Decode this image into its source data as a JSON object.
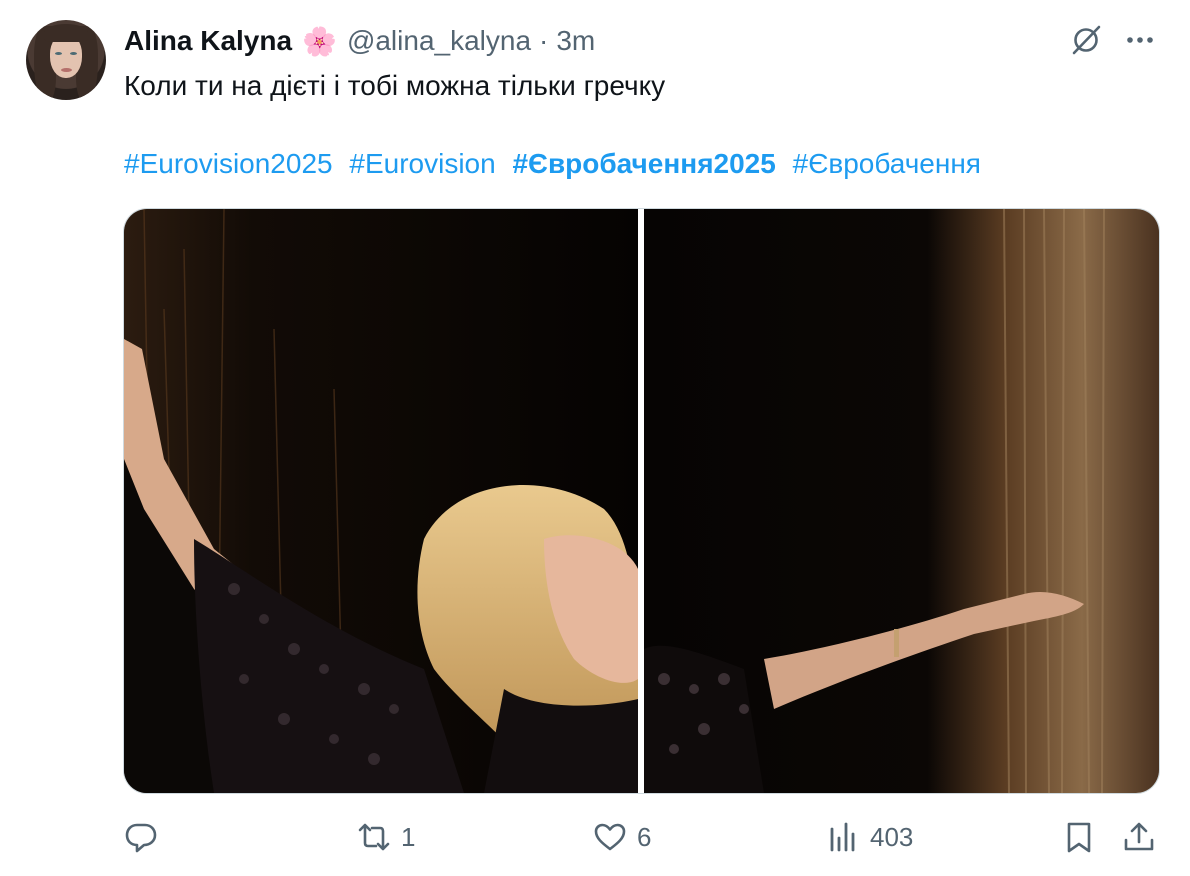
{
  "author": {
    "name": "Alina Kalyna",
    "emoji": "🌸",
    "handle": "@alina_kalyna",
    "separator": "·",
    "time": "3m"
  },
  "tweet": {
    "text": "Коли ти на дієті і тобі можна тільки гречку",
    "hashtags": [
      {
        "label": "#Eurovision2025",
        "bold": false
      },
      {
        "label": "#Eurovision",
        "bold": false
      },
      {
        "label": "#Євробачення2025",
        "bold": true
      },
      {
        "label": "#Євробачення",
        "bold": false
      }
    ]
  },
  "media": {
    "images": [
      {
        "name": "left-photo-singer-lace-dress"
      },
      {
        "name": "right-photo-arm-in-buckwheat-stream"
      }
    ]
  },
  "actions": {
    "reply_count": "",
    "retweet_count": "1",
    "like_count": "6",
    "views_count": "403"
  },
  "icons": {
    "reply": "reply-icon",
    "retweet": "retweet-icon",
    "like": "heart-icon",
    "views": "views-icon",
    "bookmark": "bookmark-icon",
    "share": "share-icon",
    "grok": "grok-icon",
    "more": "more-icon"
  },
  "colors": {
    "link": "#1d9bf0",
    "text": "#0f1419",
    "secondary": "#536471",
    "border": "#cfd9de"
  }
}
